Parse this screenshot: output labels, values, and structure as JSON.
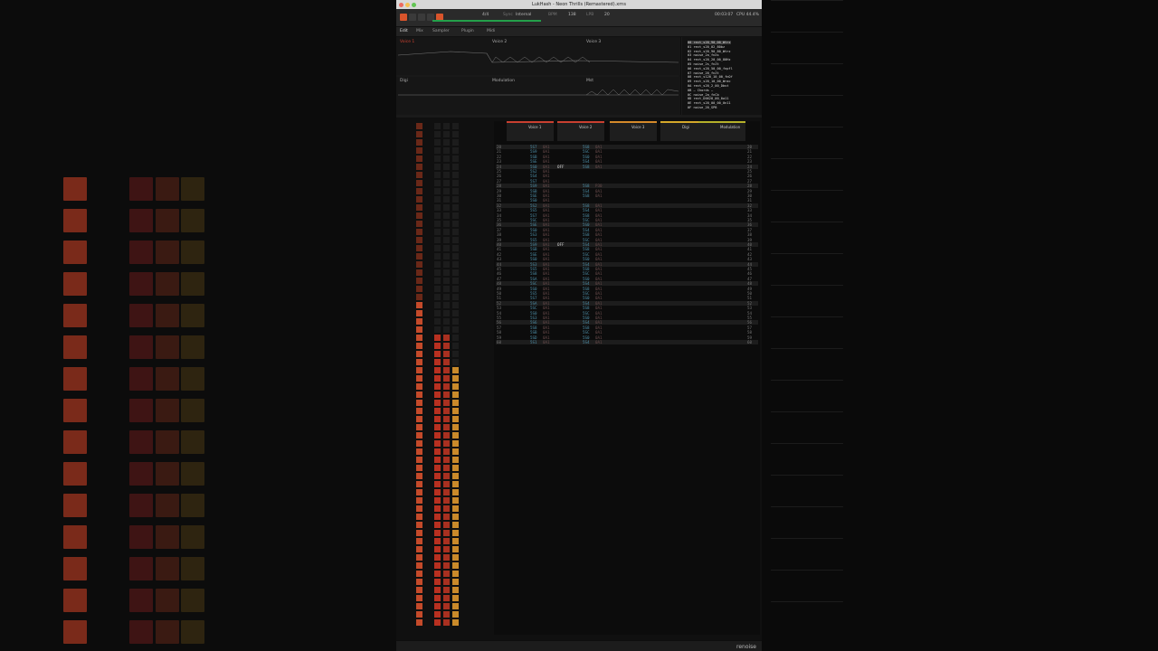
{
  "window": {
    "title": "LukHash - Neon Thrills (Remastered).xrns"
  },
  "transport": {
    "sync_label": "Sync",
    "sync_value": "Internal",
    "lpb_label": "LPB",
    "bpm_label": "BPM",
    "bpm_value": "138",
    "time": "00:03:07",
    "cpu": "CPU 44.4%",
    "meter": "4/4",
    "lpb_value": "20"
  },
  "tabs": [
    "Edit",
    "Mix",
    "Sampler",
    "Plugin",
    "Midi"
  ],
  "automation": {
    "lanes": [
      {
        "label": "Voice 1"
      },
      {
        "label": "Voice 2"
      },
      {
        "label": "Voice 3"
      },
      {
        "label": "Digi"
      },
      {
        "label": "Modulation"
      },
      {
        "label": "Mst"
      }
    ]
  },
  "instruments": {
    "items": [
      "00  rect_s20_90_00_Wtrz",
      "01  rect_s20_02_80bz",
      "02  rect_s20_90_80_Wtrz",
      "03  noise_2a_fnXs",
      "04  rect_s20_20_00_80Hz",
      "05  noise_2s_fnZt",
      "06  rect_s20_50_00_fnpfl",
      "07  noise_20_fnZt",
      "08  rect_s120_10_00_fnOf",
      "09  rect_s20_10_00_Wrac",
      "0A  rect_s20_2_00_Dbst",
      "0B  — Chords —",
      "0C  noise_2a_fnCb",
      "0D  rect_D0628_00_0a11",
      "0E  rect_s20_00_00_0n11",
      "0F  noise_20_SPB"
    ]
  },
  "tracks": [
    {
      "name": "Voice 1",
      "color": "#c94030"
    },
    {
      "name": "Voice 2",
      "color": "#c94030"
    },
    {
      "name": "Voice 3",
      "color": "#d58a2a"
    },
    {
      "name": "Digi",
      "color": "#d5a82a"
    },
    {
      "name": "Modulation",
      "color": "#b5b02a"
    }
  ],
  "sequencer": {
    "headers": [
      "Voice 1",
      "Voice 3",
      "Modul",
      "Voice 2",
      "Digi",
      "Mst"
    ]
  },
  "pattern": {
    "rows": [
      {
        "n": "20",
        "v1": "5S7",
        "f1": "0A1",
        "v2": "5S8",
        "f2": "0A1"
      },
      {
        "n": "21",
        "v1": "5S9",
        "f1": "0A1",
        "v2": "5SC",
        "f2": "0A1"
      },
      {
        "n": "22",
        "v1": "5SB",
        "f1": "0A1",
        "v2": "5S0",
        "f2": "0A1"
      },
      {
        "n": "23",
        "v1": "5SE",
        "f1": "0A1",
        "v2": "5S4",
        "f2": "0A1"
      },
      {
        "n": "24",
        "v1": "5S0",
        "f1": "0A1",
        "v2": "5S8",
        "f2": "0A1"
      },
      {
        "n": "25",
        "v1": "5S2",
        "f1": "0A1",
        "v2": "",
        "f2": ""
      },
      {
        "n": "26",
        "v1": "5S4",
        "f1": "0A1",
        "v2": "",
        "f2": ""
      },
      {
        "n": "27",
        "v1": "5S7",
        "f1": "0A1",
        "v2": "",
        "f2": ""
      },
      {
        "n": "28",
        "v1": "5S9",
        "f1": "0A1",
        "v2": "5S8",
        "f2": "P30"
      },
      {
        "n": "29",
        "v1": "5SB",
        "f1": "0A1",
        "v2": "5S4",
        "f2": "0A1"
      },
      {
        "n": "30",
        "v1": "5SE",
        "f1": "0A1",
        "v2": "5S8",
        "f2": "0A1"
      },
      {
        "n": "31",
        "v1": "5S0",
        "f1": "0A1",
        "v2": "",
        "f2": ""
      },
      {
        "n": "32",
        "v1": "5S2",
        "f1": "0A1",
        "v2": "5S8",
        "f2": "0A1"
      },
      {
        "n": "33",
        "v1": "5S5",
        "f1": "0A1",
        "v2": "5S4",
        "f2": "0A1"
      },
      {
        "n": "34",
        "v1": "5S7",
        "f1": "0A1",
        "v2": "5S8",
        "f2": "0A1"
      },
      {
        "n": "35",
        "v1": "5SC",
        "f1": "0A1",
        "v2": "5SC",
        "f2": "0A1"
      },
      {
        "n": "36",
        "v1": "5SE",
        "f1": "0A1",
        "v2": "5S0",
        "f2": "0A1"
      },
      {
        "n": "37",
        "v1": "5S0",
        "f1": "0A1",
        "v2": "5S4",
        "f2": "0A1"
      },
      {
        "n": "38",
        "v1": "5S3",
        "f1": "0A1",
        "v2": "5S8",
        "f2": "0A1"
      },
      {
        "n": "39",
        "v1": "5S5",
        "f1": "0A1",
        "v2": "5SC",
        "f2": "0A1"
      },
      {
        "n": "40",
        "v1": "5S9",
        "f1": "0A1",
        "v2": "5S4",
        "f2": "0A1"
      },
      {
        "n": "41",
        "v1": "5SB",
        "f1": "0A1",
        "v2": "5S8",
        "f2": "0A1"
      },
      {
        "n": "42",
        "v1": "5SE",
        "f1": "0A1",
        "v2": "5SC",
        "f2": "0A1"
      },
      {
        "n": "43",
        "v1": "5S0",
        "f1": "0A1",
        "v2": "5S0",
        "f2": "0A1"
      },
      {
        "n": "44",
        "v1": "5S3",
        "f1": "0A1",
        "v2": "5S4",
        "f2": "0A1"
      },
      {
        "n": "45",
        "v1": "5S5",
        "f1": "0A1",
        "v2": "5S8",
        "f2": "0A1"
      },
      {
        "n": "46",
        "v1": "5S8",
        "f1": "0A1",
        "v2": "5SC",
        "f2": "0A1"
      },
      {
        "n": "47",
        "v1": "5SA",
        "f1": "0A1",
        "v2": "5S0",
        "f2": "0A1"
      },
      {
        "n": "48",
        "v1": "5SC",
        "f1": "0A1",
        "v2": "5S4",
        "f2": "0A1"
      },
      {
        "n": "49",
        "v1": "5S0",
        "f1": "0A1",
        "v2": "5S8",
        "f2": "0A1"
      },
      {
        "n": "50",
        "v1": "5S5",
        "f1": "0A1",
        "v2": "5SC",
        "f2": "0A1"
      },
      {
        "n": "51",
        "v1": "5S7",
        "f1": "0A1",
        "v2": "5S0",
        "f2": "0A1"
      },
      {
        "n": "52",
        "v1": "5SA",
        "f1": "0A1",
        "v2": "5S4",
        "f2": "0A1"
      },
      {
        "n": "53",
        "v1": "5SC",
        "f1": "0A1",
        "v2": "5S8",
        "f2": "0A1"
      },
      {
        "n": "54",
        "v1": "5S0",
        "f1": "0A1",
        "v2": "5SC",
        "f2": "0A1"
      },
      {
        "n": "55",
        "v1": "5S3",
        "f1": "0A1",
        "v2": "5S0",
        "f2": "0A1"
      },
      {
        "n": "56",
        "v1": "5S6",
        "f1": "0A1",
        "v2": "5S4",
        "f2": "0A1"
      },
      {
        "n": "57",
        "v1": "5S8",
        "f1": "0A1",
        "v2": "5S8",
        "f2": "0A1"
      },
      {
        "n": "58",
        "v1": "5SB",
        "f1": "0A1",
        "v2": "5SC",
        "f2": "0A1"
      },
      {
        "n": "59",
        "v1": "5SD",
        "f1": "0A1",
        "v2": "5S0",
        "f2": "0A1"
      },
      {
        "n": "60",
        "v1": "5S1",
        "f1": "0A1",
        "v2": "5S4",
        "f2": "0A1"
      }
    ],
    "off_label": "OFF"
  },
  "status": {
    "logo": "renoise",
    "page": "1"
  }
}
